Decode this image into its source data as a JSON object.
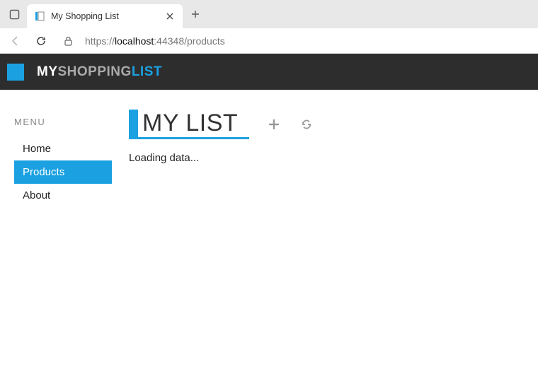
{
  "browser": {
    "tab_title": "My Shopping List",
    "url_prefix": "https://",
    "url_host": "localhost",
    "url_rest": ":44348/products"
  },
  "header": {
    "brand_p1": "MY",
    "brand_p2": "SHOPPING",
    "brand_p3": "LIST"
  },
  "sidebar": {
    "label": "MENU",
    "items": [
      {
        "label": "Home",
        "active": false
      },
      {
        "label": "Products",
        "active": true
      },
      {
        "label": "About",
        "active": false
      }
    ]
  },
  "content": {
    "title": "MY LIST",
    "loading": "Loading data..."
  },
  "colors": {
    "accent": "#1ba1e2",
    "header_bg": "#2d2d2d"
  }
}
